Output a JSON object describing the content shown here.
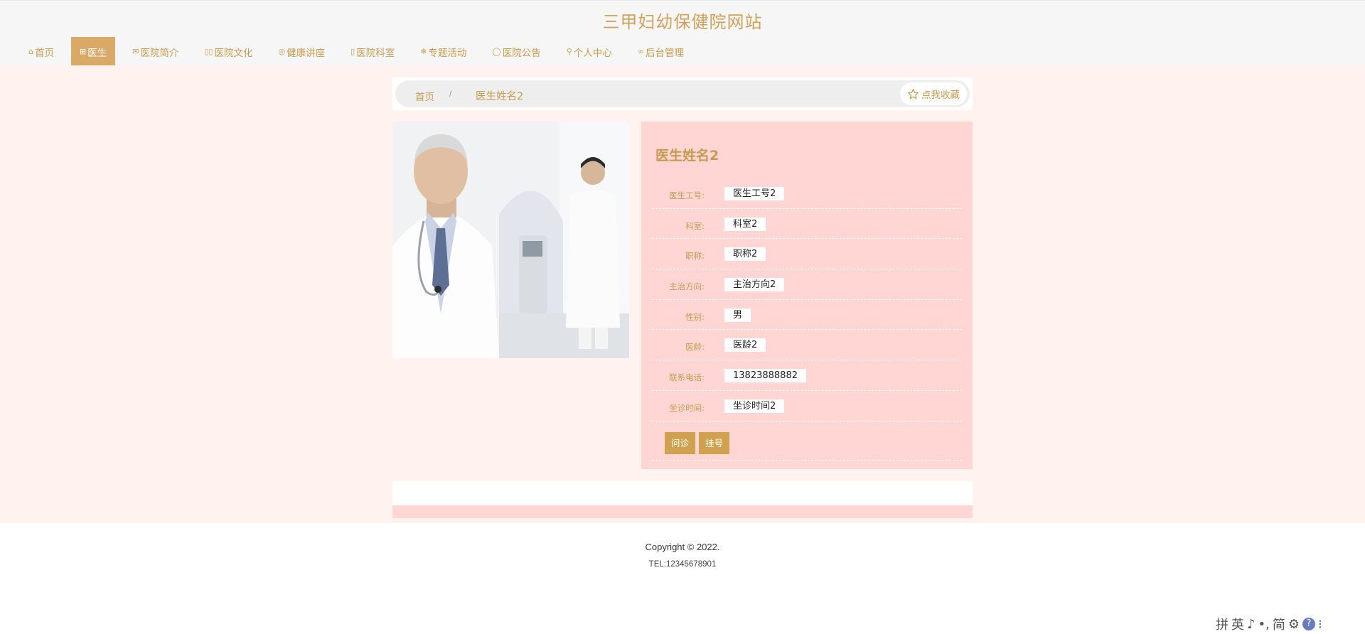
{
  "site": {
    "title": "三甲妇幼保健院网站"
  },
  "nav": [
    {
      "icon": "home-icon",
      "glyph": "⌂",
      "label": "首页",
      "active": false
    },
    {
      "icon": "doctor-icon",
      "glyph": "⊞",
      "label": "医生",
      "active": true
    },
    {
      "icon": "mail-icon",
      "glyph": "✉",
      "label": "医院简介",
      "active": false
    },
    {
      "icon": "culture-icon",
      "glyph": "▯▯",
      "label": "医院文化",
      "active": false
    },
    {
      "icon": "lecture-icon",
      "glyph": "◎",
      "label": "健康讲座",
      "active": false
    },
    {
      "icon": "department-icon",
      "glyph": "▯",
      "label": "医院科室",
      "active": false
    },
    {
      "icon": "activity-icon",
      "glyph": "❄",
      "label": "专题活动",
      "active": false
    },
    {
      "icon": "notice-icon",
      "glyph": "◯",
      "label": "医院公告",
      "active": false
    },
    {
      "icon": "user-icon",
      "glyph": "⚲",
      "label": "个人中心",
      "active": false
    },
    {
      "icon": "link-icon",
      "glyph": "∞",
      "label": "后台管理",
      "active": false
    }
  ],
  "breadcrumb": {
    "home": "首页",
    "sep": "/",
    "current": "医生姓名2"
  },
  "favorite": {
    "label": "点我收藏",
    "icon": "star-icon"
  },
  "doctor": {
    "name": "医生姓名2",
    "fields": [
      {
        "label": "医生工号:",
        "value": "医生工号2"
      },
      {
        "label": "科室:",
        "value": "科室2"
      },
      {
        "label": "职称:",
        "value": "职称2"
      },
      {
        "label": "主治方向:",
        "value": "主治方向2"
      },
      {
        "label": "性别:",
        "value": "男"
      },
      {
        "label": "医龄:",
        "value": "医龄2"
      },
      {
        "label": "联系电话:",
        "value": "13823888882"
      },
      {
        "label": "坐诊时间:",
        "value": "坐诊时间2"
      }
    ],
    "actions": {
      "consult": "问诊",
      "register": "挂号"
    }
  },
  "footer": {
    "copyright": "Copyright © 2022.",
    "tel": "TEL:12345678901"
  },
  "ime": [
    "拼",
    "英",
    "♪",
    "•,",
    "简",
    "⚙",
    "?",
    "⁝"
  ],
  "colors": {
    "accent": "#d0a15a",
    "nav_active": "#d9a968",
    "page_bg": "#fff2ef",
    "panel_bg": "#ffd6d4",
    "button": "#d0a14e"
  }
}
